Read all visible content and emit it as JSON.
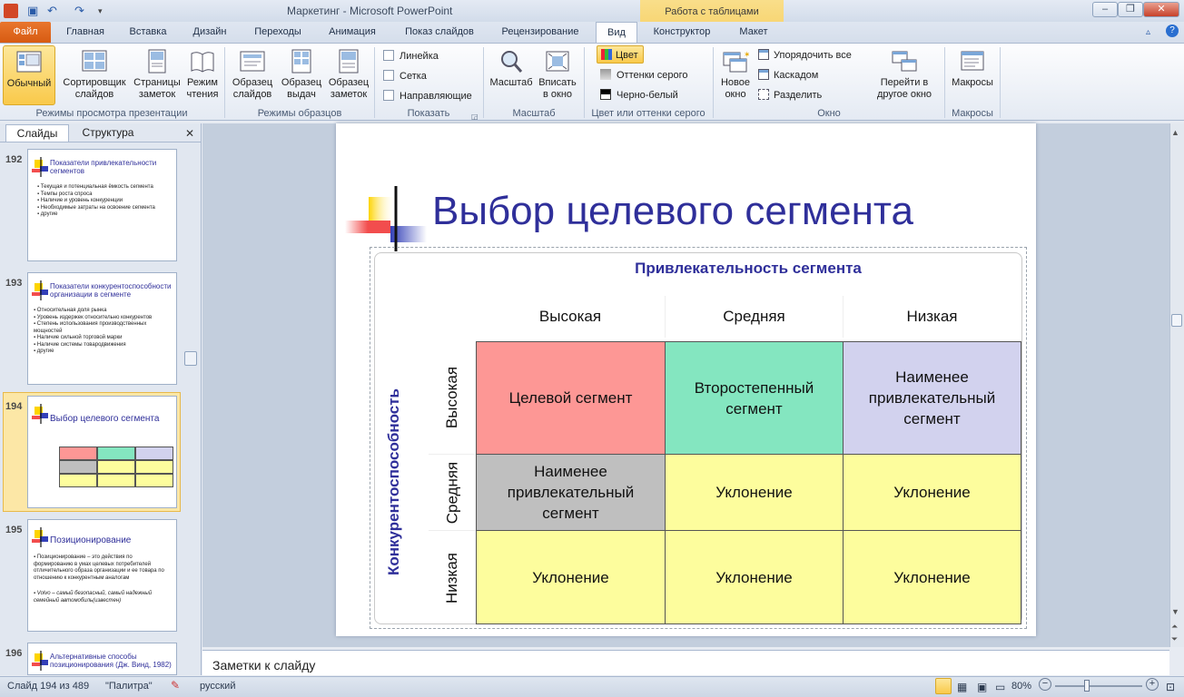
{
  "window": {
    "title": "Маркетинг  -  Microsoft PowerPoint",
    "context_group": "Работа с таблицами",
    "colors": {
      "accent_file": "#e36c1f",
      "context": "#f7d36e",
      "title_blue": "#2f2f9a"
    }
  },
  "tabs": [
    "Файл",
    "Главная",
    "Вставка",
    "Дизайн",
    "Переходы",
    "Анимация",
    "Показ слайдов",
    "Рецензирование",
    "Вид",
    "Конструктор",
    "Макет"
  ],
  "ribbon": {
    "view_modes": {
      "group": "Режимы просмотра презентации",
      "buttons": [
        "Обычный",
        "Сортировщик слайдов",
        "Страницы заметок",
        "Режим чтения"
      ]
    },
    "masters": {
      "group": "Режимы образцов",
      "buttons": [
        "Образец слайдов",
        "Образец выдач",
        "Образец заметок"
      ]
    },
    "show": {
      "group": "Показать",
      "items": [
        "Линейка",
        "Сетка",
        "Направляющие"
      ]
    },
    "zoom": {
      "group": "Масштаб",
      "buttons": [
        "Масштаб",
        "Вписать в окно"
      ]
    },
    "color": {
      "group": "Цвет или оттенки серого",
      "items": [
        "Цвет",
        "Оттенки серого",
        "Черно-белый"
      ]
    },
    "window": {
      "group": "Окно",
      "new_window": "Новое окно",
      "items": [
        "Упорядочить все",
        "Каскадом",
        "Разделить"
      ],
      "switch": "Перейти в другое окно"
    },
    "macros": {
      "group": "Макросы",
      "button": "Макросы"
    }
  },
  "panel": {
    "tabs": [
      "Слайды",
      "Структура"
    ],
    "thumbs": [
      {
        "num": "192",
        "title": "Показатели привлекательности сегментов",
        "bullets": [
          "Текущая и потенциальная ёмкость сегмента",
          "Темпы роста спроса",
          "Наличие и уровень конкуренции",
          "Необходимые затраты на освоение сегмента",
          "другие"
        ]
      },
      {
        "num": "193",
        "title": "Показатели конкурентоспособности организации в сегменте",
        "bullets": [
          "Относительная доля рынка",
          "Уровень издержек относительно конкурентов",
          "Степень использования производственных мощностей",
          "Наличие сильной торговой марки",
          "Наличие системы товародвижения",
          "другие"
        ]
      },
      {
        "num": "194",
        "title": "Выбор целевого сегмента",
        "bullets": []
      },
      {
        "num": "195",
        "title": "Позиционирование",
        "bullets": [
          "Позиционирование – это действия по формированию в умах целевых потребителей отличительного образа организации и ее товара по отношению к конкурентным аналогам",
          "Volvo – самый безопасный, самый надежный семейный автомобиль(известен)"
        ]
      },
      {
        "num": "196",
        "title": "Альтернативные способы позиционирования (Дж. Винд, 1982)",
        "bullets": []
      }
    ]
  },
  "slide": {
    "title": "Выбор целевого сегмента",
    "attr_header": "Привлекательность  сегмента",
    "competitiveness_header": "Конкурентоспособность",
    "cols": [
      "Высокая",
      "Средняя",
      "Низкая"
    ],
    "rows": [
      "Высокая",
      "Средняя",
      "Низкая"
    ],
    "cells": [
      [
        "Целевой сегмент",
        "Второстепенный сегмент",
        "Наименее привлекательный сегмент"
      ],
      [
        "Наименее привлекательный сегмент",
        "Уклонение",
        "Уклонение"
      ],
      [
        "Уклонение",
        "Уклонение",
        "Уклонение"
      ]
    ],
    "cell_colors": [
      [
        "#fd9795",
        "#84e6c0",
        "#d2d2ee"
      ],
      [
        "#bfbfbf",
        "#fdfd9d",
        "#fdfd9d"
      ],
      [
        "#fdfd9d",
        "#fdfd9d",
        "#fdfd9d"
      ]
    ]
  },
  "notes": {
    "placeholder": "Заметки к слайду"
  },
  "status": {
    "slide": "Слайд 194 из 489",
    "theme": "\"Палитра\"",
    "lang": "русский",
    "zoom": "80%"
  }
}
